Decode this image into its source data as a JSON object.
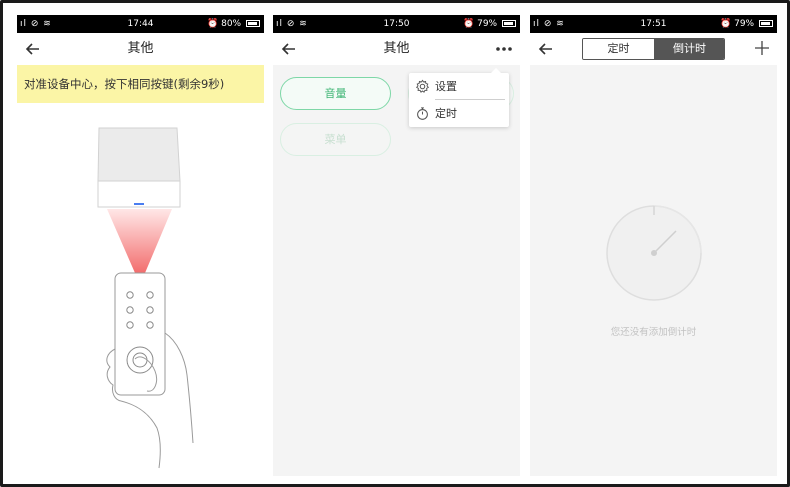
{
  "screens": [
    {
      "status": {
        "signal": "▐▌⊘",
        "time": "17:44",
        "battery": "80%"
      },
      "nav": {
        "title": "其他"
      },
      "banner": "对准设备中心，按下相同按键(剩余9秒)"
    },
    {
      "status": {
        "signal": "▐▌⊘",
        "time": "17:50",
        "battery": "79%"
      },
      "nav": {
        "title": "其他"
      },
      "buttons": {
        "volume": "音量",
        "menu": "菜单"
      },
      "dropdown": {
        "settings": "设置",
        "timer": "定时"
      }
    },
    {
      "status": {
        "signal": "▐▌⊘",
        "time": "17:51",
        "battery": "79%"
      },
      "tabs": {
        "timer": "定时",
        "countdown": "倒计时",
        "active": "countdown"
      },
      "empty_text": "您还没有添加倒计时"
    }
  ],
  "colors": {
    "banner_bg": "#fbf5a6",
    "accent_green": "#3eb574",
    "tab_active_bg": "#555555"
  }
}
